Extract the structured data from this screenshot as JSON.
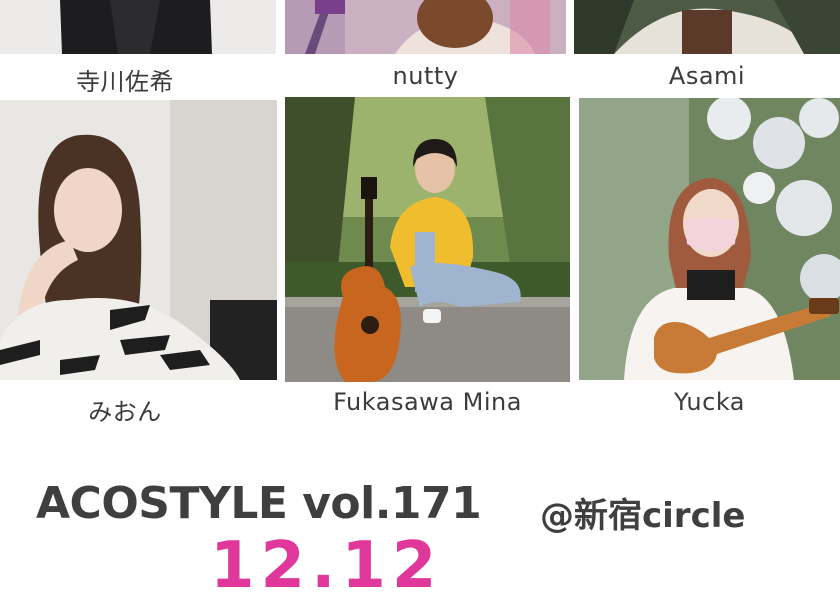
{
  "performers": [
    {
      "name": "寺川佐希"
    },
    {
      "name": "nutty"
    },
    {
      "name": "Asami"
    },
    {
      "name": "みおん"
    },
    {
      "name": "Fukasawa Mina"
    },
    {
      "name": "Yucka"
    }
  ],
  "event": {
    "title": "ACOSTYLE vol.171",
    "venue": "@新宿circle",
    "date": "12.12"
  },
  "colors": {
    "date_accent": "#e0389a",
    "text": "#3c3c3c"
  }
}
